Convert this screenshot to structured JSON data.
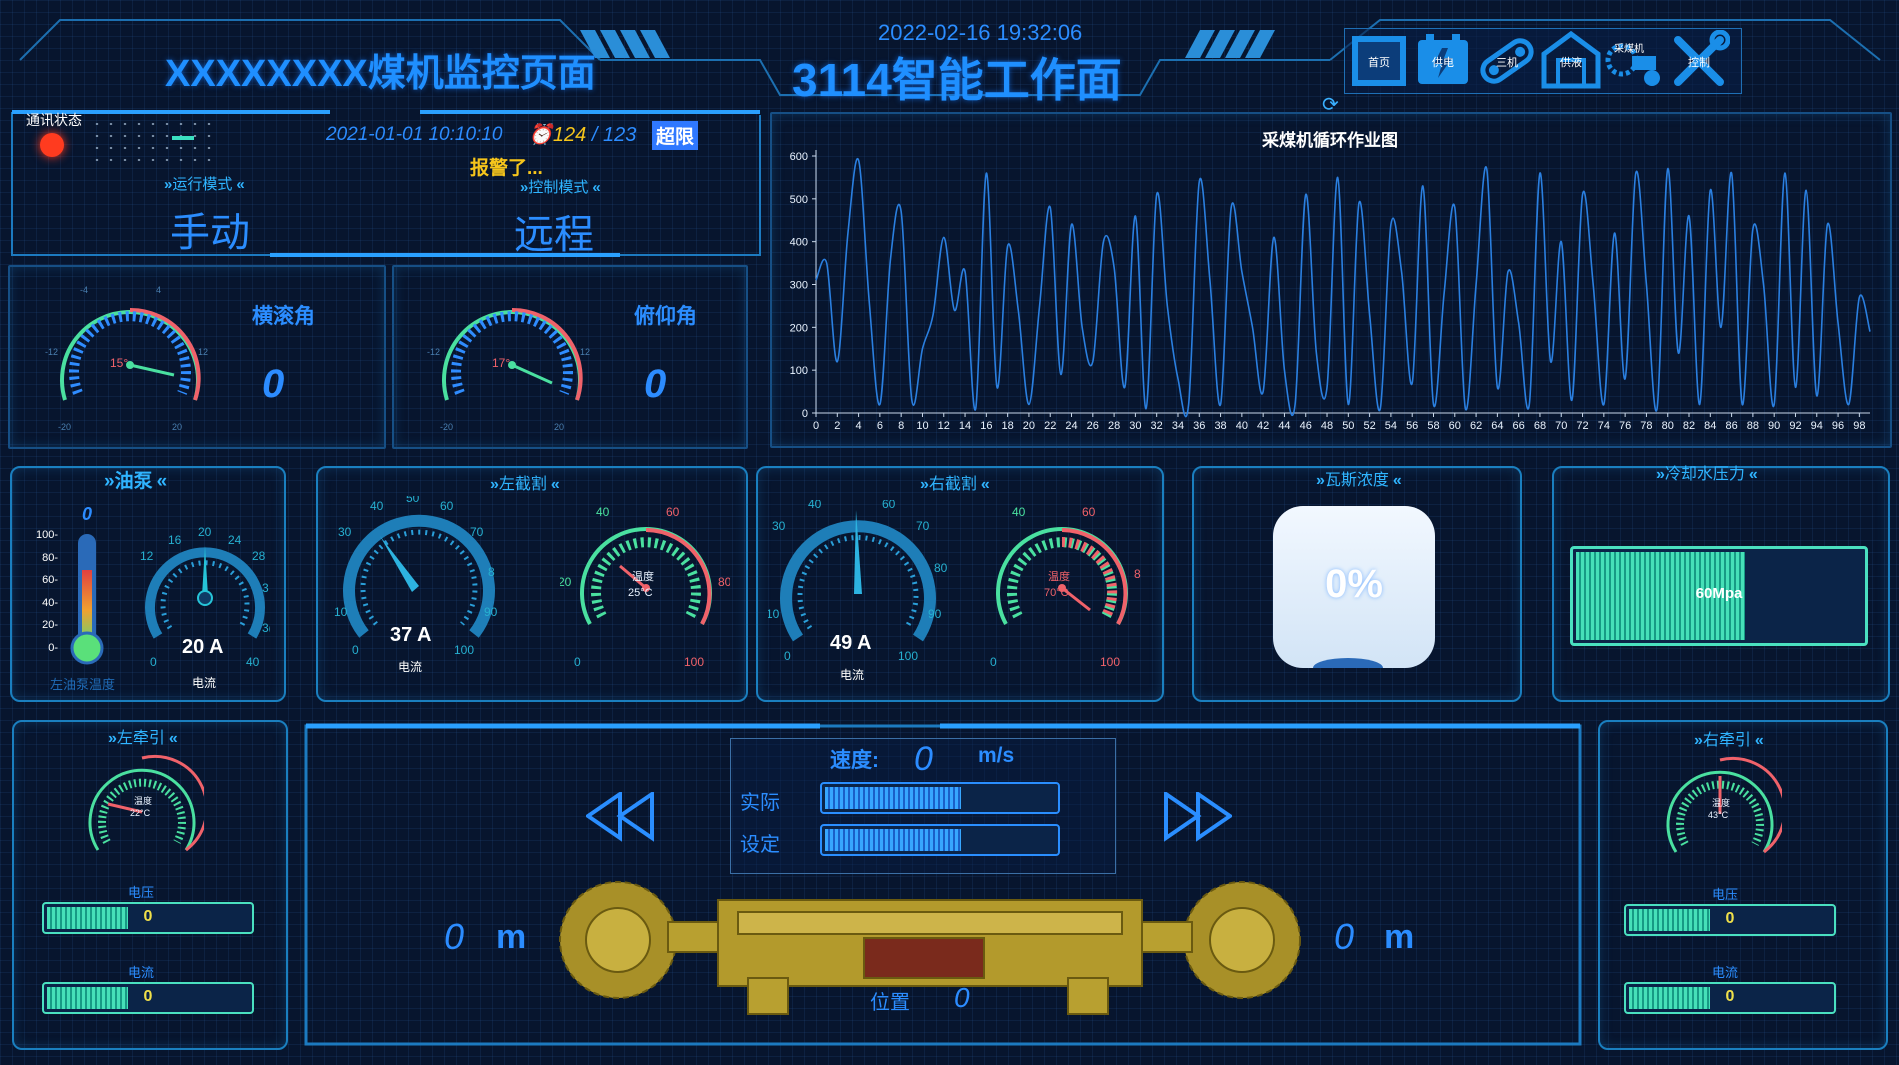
{
  "header": {
    "title_left": "XXXXXXXX煤机监控页面",
    "datetime": "2022-02-16 19:32:06",
    "title_center": "3114智能工作面",
    "nav": [
      {
        "label": "首页",
        "icon": "home-icon"
      },
      {
        "label": "供电",
        "icon": "power-icon"
      },
      {
        "label": "三机",
        "icon": "conveyor-icon"
      },
      {
        "label": "供液",
        "icon": "pump-house-icon"
      },
      {
        "label": "采煤机",
        "icon": "shearer-icon"
      },
      {
        "label": "控制",
        "icon": "tools-icon"
      }
    ]
  },
  "status": {
    "comm_label": "通讯状态",
    "comm_color": "#ff3b1f",
    "timestamp": "2021-01-01 10:10:10",
    "alarm_count": "124",
    "alarm_total": "123",
    "over_limit": "超限",
    "alarm_text": "报警了...",
    "run_mode_label": "运行模式",
    "run_mode_value": "手动",
    "control_mode_label": "控制模式",
    "control_mode_value": "远程"
  },
  "angles": {
    "roll_label": "横滚角",
    "roll_value": "0",
    "roll_gauge": "15°",
    "pitch_label": "俯仰角",
    "pitch_value": "0",
    "pitch_gauge": "17°",
    "ticks": {
      "min": "-20",
      "low": "-12",
      "mid_low": "-4",
      "mid_high": "4",
      "high": "12",
      "max": "20"
    }
  },
  "chart_data": {
    "type": "line",
    "title": "采煤机循环作业图",
    "ylim": [
      0,
      600
    ],
    "yticks": [
      0,
      100,
      200,
      300,
      400,
      500,
      600
    ],
    "x": [
      0,
      1,
      2,
      3,
      4,
      5,
      6,
      7,
      8,
      9,
      10,
      11,
      12,
      13,
      14,
      15,
      16,
      17,
      18,
      19,
      20,
      21,
      22,
      23,
      24,
      25,
      26,
      27,
      28,
      29,
      30,
      31,
      32,
      33,
      34,
      35,
      36,
      37,
      38,
      39,
      40,
      41,
      42,
      43,
      44,
      45,
      46,
      47,
      48,
      49,
      50,
      51,
      52,
      53,
      54,
      55,
      56,
      57,
      58,
      59,
      60,
      61,
      62,
      63,
      64,
      65,
      66,
      67,
      68,
      69,
      70,
      71,
      72,
      73,
      74,
      75,
      76,
      77,
      78,
      79,
      80,
      81,
      82,
      83,
      84,
      85,
      86,
      87,
      88,
      89,
      90,
      91,
      92,
      93,
      94,
      95,
      96,
      97,
      98,
      99
    ],
    "series": [
      {
        "color": "#2a7fe0",
        "values": [
          310,
          350,
          120,
          420,
          590,
          260,
          20,
          360,
          470,
          30,
          150,
          230,
          410,
          240,
          330,
          10,
          560,
          60,
          390,
          240,
          20,
          250,
          480,
          90,
          440,
          200,
          120,
          400,
          340,
          60,
          460,
          10,
          510,
          250,
          80,
          20,
          540,
          310,
          20,
          480,
          330,
          200,
          50,
          410,
          100,
          20,
          510,
          140,
          60,
          550,
          20,
          490,
          230,
          10,
          440,
          330,
          70,
          530,
          20,
          280,
          480,
          10,
          300,
          570,
          60,
          330,
          210,
          20,
          560,
          120,
          400,
          30,
          510,
          300,
          20,
          420,
          80,
          560,
          300,
          10,
          570,
          140,
          460,
          20,
          520,
          200,
          560,
          20,
          430,
          300,
          20,
          560,
          60,
          520,
          40,
          440,
          210,
          20,
          270,
          190
        ]
      }
    ],
    "xticks": [
      0,
      2,
      4,
      6,
      8,
      10,
      12,
      14,
      16,
      18,
      20,
      22,
      24,
      26,
      28,
      30,
      32,
      34,
      36,
      38,
      40,
      42,
      44,
      46,
      48,
      50,
      52,
      54,
      56,
      58,
      60,
      62,
      64,
      66,
      68,
      70,
      72,
      74,
      76,
      78,
      80,
      82,
      84,
      86,
      88,
      90,
      92,
      94,
      96,
      98
    ]
  },
  "oil_pump": {
    "title": "油泵",
    "temp_value": "0",
    "temp_label": "左油泵温度",
    "temp_ticks": [
      "100-",
      "80-",
      "60-",
      "40-",
      "20-",
      "0-"
    ],
    "current_value": "20 A",
    "current_label": "电流",
    "current_fraction": 0.5,
    "current_ticks": [
      "0",
      "12",
      "16",
      "20",
      "24",
      "28",
      "3",
      "3(",
      "40"
    ]
  },
  "left_cut": {
    "title": "左截割",
    "current_value": "37 A",
    "current_label": "电流",
    "current_fraction": 0.37,
    "current_ticks": [
      "0",
      "10",
      "30",
      "40",
      "50",
      "60",
      "70",
      "8",
      "90",
      "100"
    ],
    "temp_label": "温度",
    "temp_value": "25°C",
    "temp_ticks": [
      "0",
      "20",
      "40",
      "60",
      "80",
      "100"
    ]
  },
  "right_cut": {
    "title": "右截割",
    "current_value": "49 A",
    "current_label": "电流",
    "current_fraction": 0.49,
    "current_ticks": [
      "0",
      "10",
      "30",
      "40",
      "50",
      "60",
      "70",
      "80",
      "90",
      "100"
    ],
    "temp_label": "温度",
    "temp_value": "70°C",
    "temp_ticks": [
      "0",
      "40",
      "60",
      "8",
      "100"
    ]
  },
  "gas": {
    "title": "瓦斯浓度",
    "value": "0%",
    "fraction": 0.0
  },
  "cooling": {
    "title": "冷却水压力",
    "value": "60Mpa",
    "fraction": 0.6
  },
  "left_traction": {
    "title": "左牵引",
    "temp_label": "温度",
    "temp_value": "22°C",
    "voltage_label": "电压",
    "voltage_value": "0",
    "voltage_fraction": 0.42,
    "current_label": "电流",
    "current_value": "0",
    "current_fraction": 0.42
  },
  "right_traction": {
    "title": "右牵引",
    "temp_label": "温度",
    "temp_value": "43°C",
    "voltage_label": "电压",
    "voltage_value": "0",
    "voltage_fraction": 0.42,
    "current_label": "电流",
    "current_value": "0",
    "current_fraction": 0.42
  },
  "center": {
    "speed_label": "速度:",
    "speed_value": "0",
    "speed_unit": "m/s",
    "actual_label": "实际",
    "actual_fraction": 0.6,
    "set_label": "设定",
    "set_fraction": 0.6,
    "left_distance": "0",
    "right_distance": "0",
    "distance_unit": "m",
    "position_label": "位置",
    "position_value": "0"
  }
}
